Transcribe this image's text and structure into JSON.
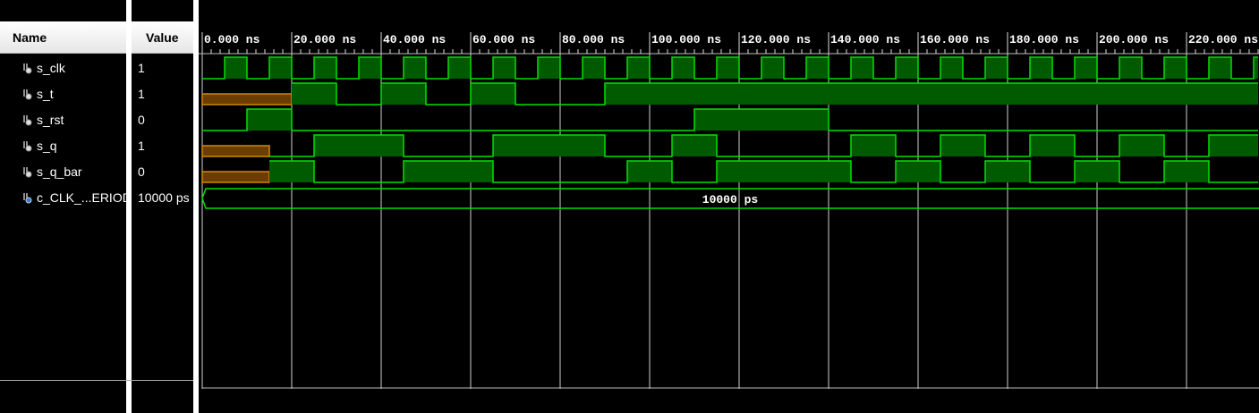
{
  "columns": {
    "name": "Name",
    "value": "Value"
  },
  "signals": [
    {
      "name": "s_clk",
      "value": "1",
      "icon": "logic-signal-icon"
    },
    {
      "name": "s_t",
      "value": "1",
      "icon": "logic-signal-icon"
    },
    {
      "name": "s_rst",
      "value": "0",
      "icon": "logic-signal-icon"
    },
    {
      "name": "s_q",
      "value": "1",
      "icon": "logic-signal-icon"
    },
    {
      "name": "s_q_bar",
      "value": "0",
      "icon": "logic-signal-icon"
    },
    {
      "name": "c_CLK_...ERIOD",
      "value": "10000 ps",
      "icon": "constant-signal-icon"
    }
  ],
  "timeline": {
    "unit": "ns",
    "ticks": [
      "0.000 ns",
      "20.000 ns",
      "40.000 ns",
      "60.000 ns",
      "80.000 ns",
      "100.000 ns",
      "120.000 ns",
      "140.000 ns",
      "160.000 ns",
      "180.000 ns",
      "200.000 ns",
      "220.000 ns"
    ]
  },
  "waveforms": {
    "s_clk": {
      "type": "clock",
      "period_ns": 10,
      "high_start_ns": 5,
      "first_rise_ns": 5
    },
    "s_t": {
      "type": "bit",
      "undefined_until_ns": 20,
      "high_ranges_ns": [
        [
          20,
          30
        ],
        [
          40,
          50
        ],
        [
          60,
          70
        ],
        [
          90,
          236
        ]
      ]
    },
    "s_rst": {
      "type": "bit",
      "high_ranges_ns": [
        [
          10,
          20
        ],
        [
          110,
          140
        ]
      ]
    },
    "s_q": {
      "type": "bit",
      "undefined_until_ns": 15,
      "high_ranges_ns": [
        [
          25,
          45
        ],
        [
          65,
          90
        ],
        [
          105,
          115
        ],
        [
          145,
          155
        ],
        [
          165,
          175
        ],
        [
          185,
          195
        ],
        [
          205,
          215
        ],
        [
          225,
          236
        ]
      ]
    },
    "s_q_bar": {
      "type": "bit",
      "undefined_until_ns": 15,
      "high_ranges_ns": [
        [
          15,
          25
        ],
        [
          45,
          65
        ],
        [
          95,
          105
        ],
        [
          115,
          145
        ],
        [
          155,
          165
        ],
        [
          175,
          185
        ],
        [
          195,
          205
        ],
        [
          215,
          225
        ]
      ]
    },
    "c_CLK_PERIOD": {
      "type": "bus",
      "label": "10000 ps"
    }
  },
  "colors": {
    "high_fill": "#005a00",
    "edge": "#00e000",
    "undefined": "#6b3d00",
    "undefined_edge": "#d08a00",
    "grid": "#ffffff",
    "bg": "#000000"
  }
}
